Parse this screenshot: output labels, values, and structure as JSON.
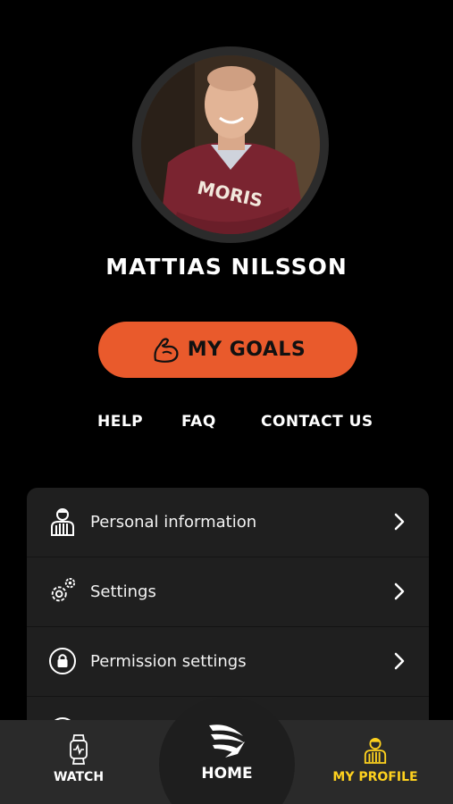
{
  "profile": {
    "name": "MATTIAS NILSSON",
    "avatar_icon": "user-photo",
    "sweater_text": "MORIS"
  },
  "goals_button": {
    "label": "MY GOALS",
    "icon": "flexed-arm-icon",
    "color": "#e95a2c"
  },
  "links": {
    "help": "HELP",
    "faq": "FAQ",
    "contact": "CONTACT US"
  },
  "menu": {
    "items": [
      {
        "label": "Personal information",
        "icon": "referee-person-icon"
      },
      {
        "label": "Settings",
        "icon": "gears-icon"
      },
      {
        "label": "Permission settings",
        "icon": "lock-circle-icon"
      }
    ]
  },
  "bottom_nav": {
    "items": [
      {
        "label": "WATCH",
        "icon": "smartwatch-icon",
        "active": false
      },
      {
        "label": "HOME",
        "icon": "brand-logo-icon",
        "active": false
      },
      {
        "label": "MY PROFILE",
        "icon": "referee-person-icon",
        "active": true
      }
    ],
    "active_color": "#ffd21e"
  }
}
